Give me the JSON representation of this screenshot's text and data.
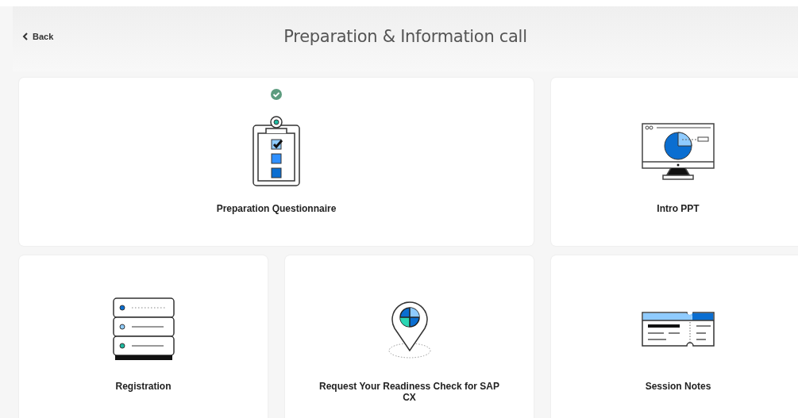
{
  "header": {
    "back": "Back",
    "title": "Preparation & Information call"
  },
  "tiles": [
    {
      "kind": "questionnaire",
      "label": "Preparation Questionnaire",
      "completed": true
    },
    {
      "kind": "presentation",
      "label": "Intro PPT",
      "completed": false
    },
    {
      "kind": "registration",
      "label": "Registration",
      "completed": false
    },
    {
      "kind": "location",
      "label": "Request Your Readiness Check for SAP CX",
      "completed": false
    },
    {
      "kind": "ticket",
      "label": "Session Notes",
      "completed": false
    }
  ]
}
